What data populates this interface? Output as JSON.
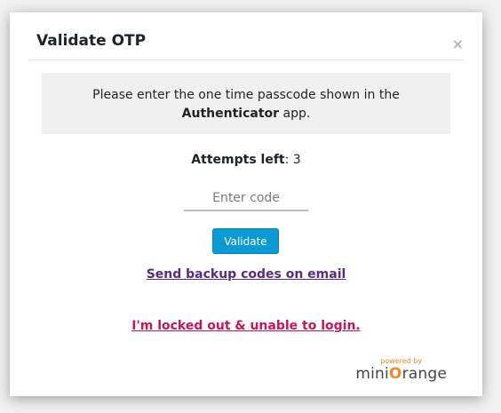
{
  "modal": {
    "title": "Validate OTP",
    "close_label": "×"
  },
  "message": {
    "line1": "Please enter the one time passcode shown in the",
    "app_name": "Authenticator",
    "suffix": " app."
  },
  "attempts": {
    "label": "Attempts left",
    "separator": ": ",
    "value": "3"
  },
  "code_input": {
    "placeholder": "Enter code",
    "value": ""
  },
  "validate_button": {
    "label": "Validate"
  },
  "links": {
    "backup_codes": "Send backup codes on email",
    "locked_out": "I'm locked out & unable to login."
  },
  "branding": {
    "powered_by": "powered by",
    "brand_prefix": "mini",
    "brand_o": "O",
    "brand_suffix": "range"
  },
  "colors": {
    "accent": "#0b9ad4",
    "backup_link": "#5b2a86",
    "locked_link": "#c2185b",
    "brand_orange": "#f08a24"
  }
}
